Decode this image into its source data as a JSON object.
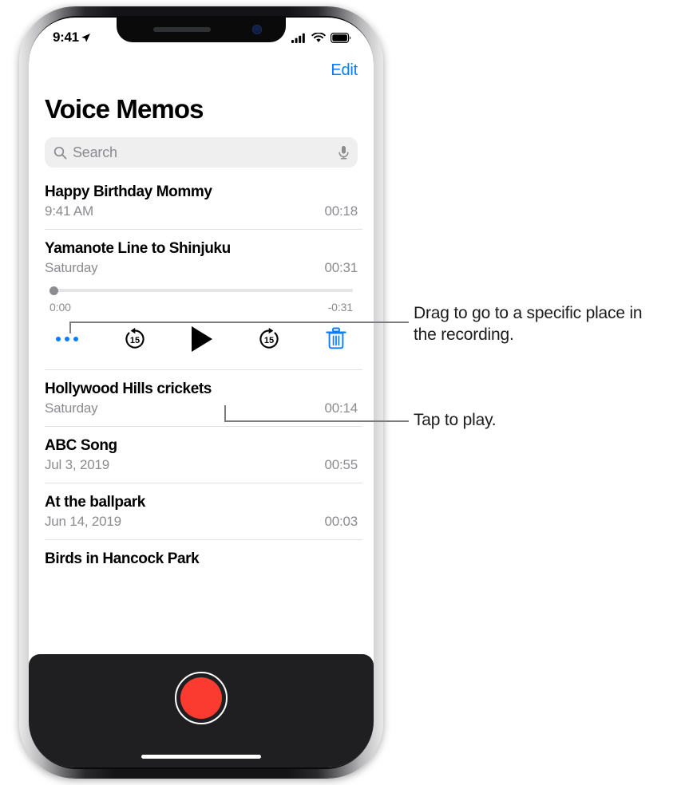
{
  "status_bar": {
    "time": "9:41",
    "location_icon": "location-arrow-icon",
    "cellular_icon": "cellular-signal-icon",
    "wifi_icon": "wifi-icon",
    "battery_icon": "battery-full-icon"
  },
  "nav": {
    "edit_label": "Edit",
    "title": "Voice Memos"
  },
  "search": {
    "placeholder": "Search",
    "search_icon": "magnifying-glass-icon",
    "dictate_icon": "microphone-icon"
  },
  "memos": [
    {
      "title": "Happy Birthday Mommy",
      "date": "9:41 AM",
      "duration": "00:18",
      "expanded": false
    },
    {
      "title": "Yamanote Line to Shinjuku",
      "date": "Saturday",
      "duration": "00:31",
      "expanded": true
    },
    {
      "title": "Hollywood Hills crickets",
      "date": "Saturday",
      "duration": "00:14",
      "expanded": false
    },
    {
      "title": "ABC Song",
      "date": "Jul 3, 2019",
      "duration": "00:55",
      "expanded": false
    },
    {
      "title": "At the ballpark",
      "date": "Jun 14, 2019",
      "duration": "00:03",
      "expanded": false
    },
    {
      "title": "Birds in Hancock Park",
      "date": "",
      "duration": "",
      "expanded": false
    }
  ],
  "player": {
    "elapsed": "0:00",
    "remaining": "-0:31",
    "progress_percent": 0,
    "controls": {
      "more_icon": "ellipsis-icon",
      "skip_back_label": "15",
      "skip_back_icon": "skip-back-15-icon",
      "play_icon": "play-icon",
      "skip_forward_label": "15",
      "skip_forward_icon": "skip-forward-15-icon",
      "delete_icon": "trash-icon"
    }
  },
  "record": {
    "button_icon": "record-button-icon"
  },
  "callouts": [
    {
      "text": "Drag to go to a specific place in the recording."
    },
    {
      "text": "Tap to play."
    }
  ],
  "colors": {
    "accent_blue": "#0a7cff",
    "record_red": "#fb3b30",
    "secondary_text": "#8b8b90",
    "panel_dark": "#1f1f21"
  }
}
